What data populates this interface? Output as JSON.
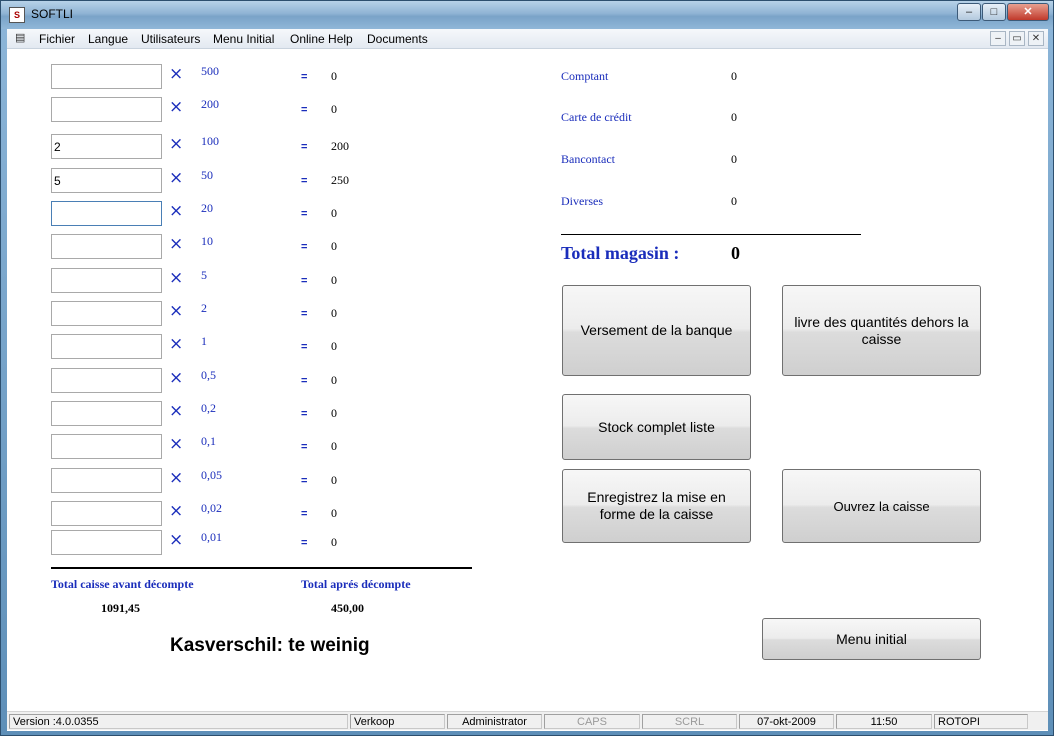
{
  "window": {
    "title": "SOFTLI",
    "minimize": "–",
    "maximize": "□",
    "close": "✕"
  },
  "menu": {
    "items": [
      "Fichier",
      "Langue",
      "Utilisateurs",
      "Menu Initial",
      "Online Help",
      "Documents"
    ],
    "mdi_buttons": [
      "–",
      "▭",
      "✕"
    ]
  },
  "denominations": [
    {
      "qty": "",
      "denom": "500",
      "result": "0"
    },
    {
      "qty": "",
      "denom": "200",
      "result": "0"
    },
    {
      "qty": "2",
      "denom": "100",
      "result": "200"
    },
    {
      "qty": "5",
      "denom": "50",
      "result": "250"
    },
    {
      "qty": "",
      "denom": "20",
      "result": "0"
    },
    {
      "qty": "",
      "denom": "10",
      "result": "0"
    },
    {
      "qty": "",
      "denom": "5",
      "result": "0"
    },
    {
      "qty": "",
      "denom": "2",
      "result": "0"
    },
    {
      "qty": "",
      "denom": "1",
      "result": "0"
    },
    {
      "qty": "",
      "denom": "0,5",
      "result": "0"
    },
    {
      "qty": "",
      "denom": "0,2",
      "result": "0"
    },
    {
      "qty": "",
      "denom": "0,1",
      "result": "0"
    },
    {
      "qty": "",
      "denom": "0,05",
      "result": "0"
    },
    {
      "qty": "",
      "denom": "0,02",
      "result": "0"
    },
    {
      "qty": "",
      "denom": "0,01",
      "result": "0"
    }
  ],
  "symbols": {
    "times": "×",
    "equals": "="
  },
  "totals": {
    "before_label": "Total caisse avant décompte",
    "before_value": "1091,45",
    "after_label": "Total aprés décompte",
    "after_value": "450,00",
    "difference_message": "Kasverschil: te weinig"
  },
  "payments": [
    {
      "label": "Comptant",
      "value": "0"
    },
    {
      "label": "Carte de crédit",
      "value": "0"
    },
    {
      "label": "Bancontact",
      "value": "0"
    },
    {
      "label": "Diverses",
      "value": "0"
    }
  ],
  "total_magasin": {
    "label": "Total magasin :",
    "value": "0"
  },
  "buttons": {
    "versement": "Versement de la banque",
    "livre": "livre des quantités dehors la caisse",
    "stock": "Stock complet liste",
    "enregistrez": "Enregistrez la mise en forme de la caisse",
    "ouvrez": "Ouvrez la caisse",
    "menu_initial": "Menu initial"
  },
  "statusbar": {
    "version": "Version :4.0.0355",
    "mode": "Verkoop",
    "user": "Administrator",
    "caps": "CAPS",
    "scrl": "SCRL",
    "date": "07-okt-2009",
    "time": "11:50",
    "company": "ROTOPI"
  }
}
